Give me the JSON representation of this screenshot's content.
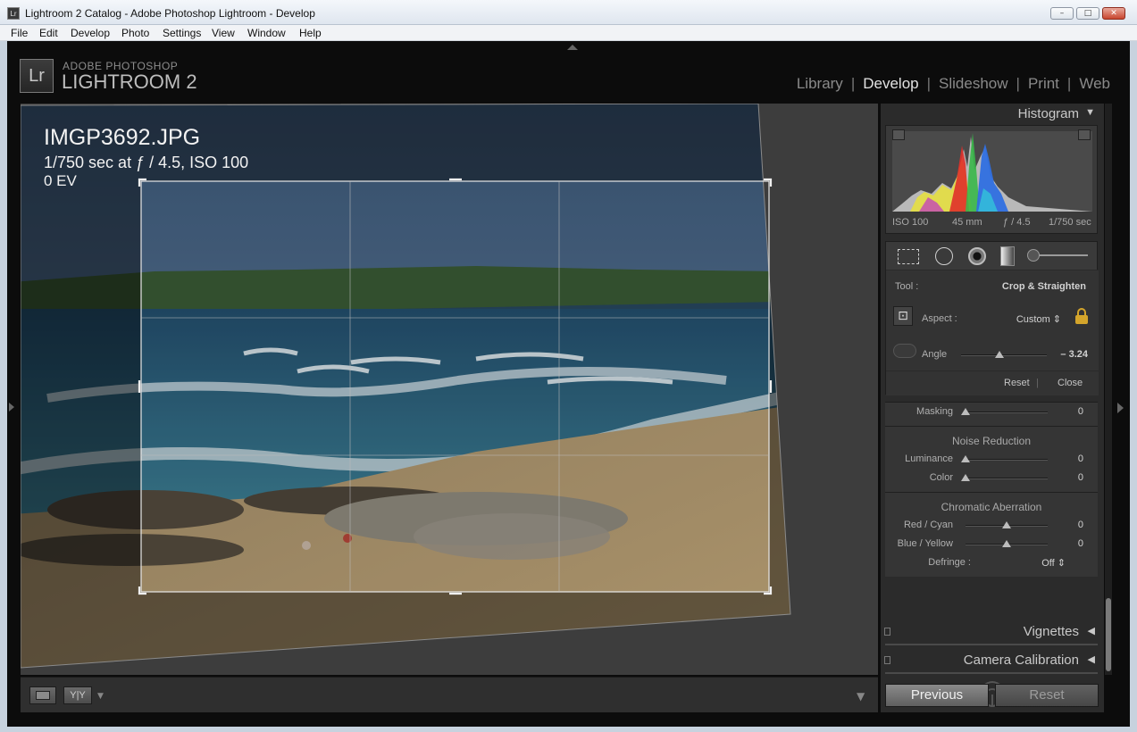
{
  "window": {
    "title": "Lightroom 2 Catalog - Adobe Photoshop Lightroom - Develop",
    "app_icon": "Lr",
    "minimize": "–",
    "maximize": "□",
    "close": "✕"
  },
  "menu": [
    "File",
    "Edit",
    "Develop",
    "Photo",
    "Settings",
    "View",
    "Window",
    "Help"
  ],
  "brand": {
    "logo": "Lr",
    "line1": "ADOBE PHOTOSHOP",
    "line2": "LIGHTROOM 2"
  },
  "modules": [
    {
      "label": "Library",
      "active": false
    },
    {
      "label": "Develop",
      "active": true
    },
    {
      "label": "Slideshow",
      "active": false
    },
    {
      "label": "Print",
      "active": false
    },
    {
      "label": "Web",
      "active": false
    }
  ],
  "photo_info": {
    "filename": "IMGP3692.JPG",
    "exposure": "1/750 sec at ƒ / 4.5, ISO 100",
    "ev": "0 EV"
  },
  "histogram": {
    "title": "Histogram",
    "iso": "ISO 100",
    "focal": "45 mm",
    "aperture": "ƒ / 4.5",
    "shutter": "1/750 sec"
  },
  "crop_tool": {
    "tool_label": "Tool :",
    "tool_value": "Crop & Straighten",
    "aspect_label": "Aspect :",
    "aspect_value": "Custom ⇕",
    "angle_label": "Angle",
    "angle_value": "– 3.24",
    "angle_fraction": 0.45,
    "reset": "Reset",
    "close": "Close"
  },
  "detail": {
    "masking": {
      "label": "Masking",
      "value": "0",
      "fraction": 0.0
    },
    "noise_title": "Noise Reduction",
    "luminance": {
      "label": "Luminance",
      "value": "0",
      "fraction": 0.0
    },
    "color": {
      "label": "Color",
      "value": "0",
      "fraction": 0.0
    },
    "ca_title": "Chromatic Aberration",
    "red_cyan": {
      "label": "Red / Cyan",
      "value": "0",
      "fraction": 0.5
    },
    "blue_yellow": {
      "label": "Blue / Yellow",
      "value": "0",
      "fraction": 0.5
    },
    "defringe_label": "Defringe :",
    "defringe_value": "Off ⇕"
  },
  "panels": {
    "vignettes": "Vignettes",
    "camera_calibration": "Camera Calibration"
  },
  "buttons": {
    "previous": "Previous",
    "reset": "Reset"
  },
  "toolbar": {
    "compare_label": "Y|Y"
  }
}
